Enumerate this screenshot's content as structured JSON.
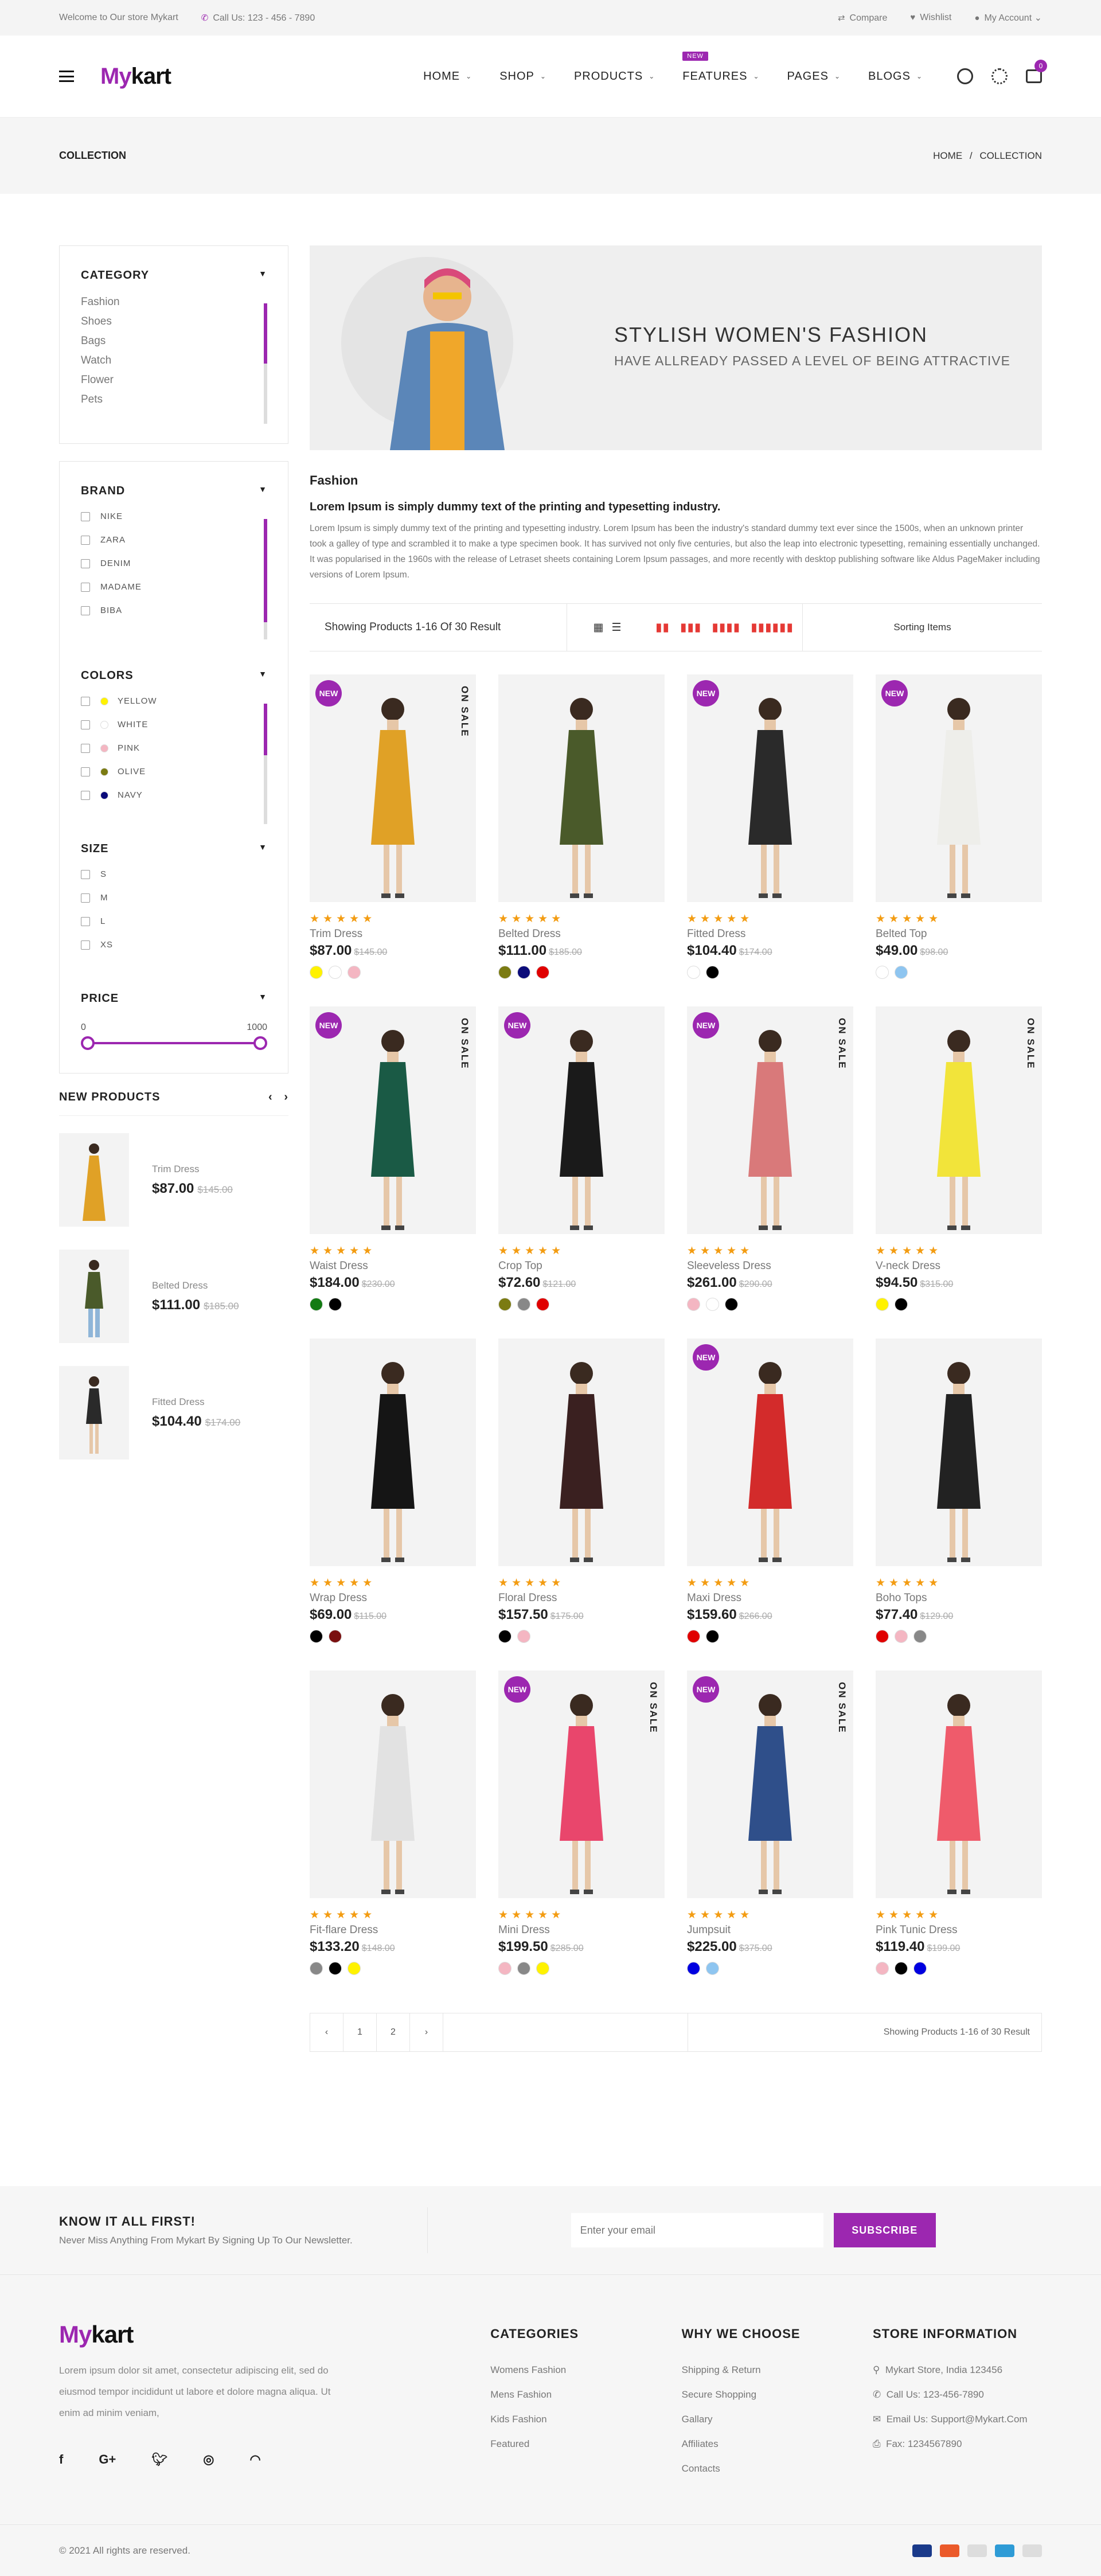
{
  "topbar": {
    "welcome": "Welcome to Our store Mykart",
    "call": "Call Us: 123 - 456 - 7890",
    "compare": "Compare",
    "wishlist": "Wishlist",
    "account": "My Account"
  },
  "header": {
    "logo_a": "My",
    "logo_b": "kart",
    "nav": [
      "HOME",
      "SHOP",
      "PRODUCTS",
      "FEATURES",
      "PAGES",
      "BLOGS"
    ],
    "new_tag": "NEW",
    "cart_count": "0"
  },
  "crumb": {
    "title": "COLLECTION",
    "home": "HOME",
    "sep": "/",
    "current": "COLLECTION"
  },
  "sidebar": {
    "category_title": "CATEGORY",
    "categories": [
      "Fashion",
      "Shoes",
      "Bags",
      "Watch",
      "Flower",
      "Pets"
    ],
    "brand_title": "BRAND",
    "brands": [
      "NIKE",
      "ZARA",
      "DENIM",
      "MADAME",
      "BIBA"
    ],
    "colors_title": "COLORS",
    "colors": [
      {
        "name": "YELLOW",
        "hex": "#fff200"
      },
      {
        "name": "WHITE",
        "hex": "#ffffff"
      },
      {
        "name": "PINK",
        "hex": "#f4b6c2"
      },
      {
        "name": "OLIVE",
        "hex": "#7b7b12"
      },
      {
        "name": "NAVY",
        "hex": "#0b0b7a"
      }
    ],
    "size_title": "SIZE",
    "sizes": [
      "S",
      "M",
      "L",
      "XS"
    ],
    "price_title": "PRICE",
    "price_min": "0",
    "price_max": "1000",
    "new_products_title": "NEW PRODUCTS",
    "new_products": [
      {
        "name": "Trim Dress",
        "price": "$87.00",
        "old": "$145.00"
      },
      {
        "name": "Belted Dress",
        "price": "$111.00",
        "old": "$185.00"
      },
      {
        "name": "Fitted Dress",
        "price": "$104.40",
        "old": "$174.00"
      }
    ]
  },
  "banner": {
    "title": "STYLISH WOMEN'S FASHION",
    "subtitle": "HAVE ALLREADY PASSED A LEVEL OF BEING ATTRACTIVE"
  },
  "desc": {
    "heading": "Fashion",
    "strong": "Lorem Ipsum is simply dummy text of the printing and typesetting industry.",
    "body": "Lorem Ipsum is simply dummy text of the printing and typesetting industry. Lorem Ipsum has been the industry's standard dummy text ever since the 1500s, when an unknown printer took a galley of type and scrambled it to make a type specimen book. It has survived not only five centuries, but also the leap into electronic typesetting, remaining essentially unchanged. It was popularised in the 1960s with the release of Letraset sheets containing Lorem Ipsum passages, and more recently with desktop publishing software like Aldus PageMaker including versions of Lorem Ipsum."
  },
  "toolbar": {
    "showing": "Showing Products 1-16 Of 30 Result",
    "sort": "Sorting Items"
  },
  "badges": {
    "new": "NEW",
    "sale": "ON SALE"
  },
  "products": [
    {
      "name": "Trim Dress",
      "price": "$87.00",
      "old": "$145.00",
      "new": true,
      "sale": true,
      "swatches": [
        "#fff200",
        "#ffffff",
        "#f4b6c2"
      ],
      "dress": "#e0a126"
    },
    {
      "name": "Belted Dress",
      "price": "$111.00",
      "old": "$185.00",
      "new": false,
      "sale": false,
      "swatches": [
        "#7b7b12",
        "#0b0b7a",
        "#e00000"
      ],
      "dress": "#4a5a2a"
    },
    {
      "name": "Fitted Dress",
      "price": "$104.40",
      "old": "$174.00",
      "new": true,
      "sale": false,
      "swatches": [
        "#ffffff",
        "#000000"
      ],
      "dress": "#2a2a2a"
    },
    {
      "name": "Belted Top",
      "price": "$49.00",
      "old": "$98.00",
      "new": true,
      "sale": false,
      "swatches": [
        "#ffffff",
        "#8ec5f0"
      ],
      "dress": "#eeeeea"
    },
    {
      "name": "Waist Dress",
      "price": "$184.00",
      "old": "$230.00",
      "new": true,
      "sale": true,
      "swatches": [
        "#137b13",
        "#000000"
      ],
      "dress": "#1a5a45"
    },
    {
      "name": "Crop Top",
      "price": "$72.60",
      "old": "$121.00",
      "new": true,
      "sale": false,
      "swatches": [
        "#7b7b12",
        "#888888",
        "#e00000"
      ],
      "dress": "#1a1a1a"
    },
    {
      "name": "Sleeveless Dress",
      "price": "$261.00",
      "old": "$290.00",
      "new": true,
      "sale": true,
      "swatches": [
        "#f4b6c2",
        "#ffffff",
        "#000000"
      ],
      "dress": "#d9797a"
    },
    {
      "name": "V-neck Dress",
      "price": "$94.50",
      "old": "$315.00",
      "new": false,
      "sale": true,
      "swatches": [
        "#fff200",
        "#000000"
      ],
      "dress": "#f2e43a"
    },
    {
      "name": "Wrap Dress",
      "price": "$69.00",
      "old": "$115.00",
      "new": false,
      "sale": false,
      "swatches": [
        "#000000",
        "#7a1010"
      ],
      "dress": "#151515"
    },
    {
      "name": "Floral Dress",
      "price": "$157.50",
      "old": "$175.00",
      "new": false,
      "sale": false,
      "swatches": [
        "#000000",
        "#f4b6c2"
      ],
      "dress": "#3a2020"
    },
    {
      "name": "Maxi Dress",
      "price": "$159.60",
      "old": "$266.00",
      "new": true,
      "sale": false,
      "swatches": [
        "#e00000",
        "#000000"
      ],
      "dress": "#d32b2b"
    },
    {
      "name": "Boho Tops",
      "price": "$77.40",
      "old": "$129.00",
      "new": false,
      "sale": false,
      "swatches": [
        "#e00000",
        "#f4b6c2",
        "#888888"
      ],
      "dress": "#222222"
    },
    {
      "name": "Fit-flare Dress",
      "price": "$133.20",
      "old": "$148.00",
      "new": false,
      "sale": false,
      "swatches": [
        "#888888",
        "#000000",
        "#fff200"
      ],
      "dress": "#e2e2e2"
    },
    {
      "name": "Mini Dress",
      "price": "$199.50",
      "old": "$285.00",
      "new": true,
      "sale": true,
      "swatches": [
        "#f4b6c2",
        "#888888",
        "#fff200"
      ],
      "dress": "#e9466c"
    },
    {
      "name": "Jumpsuit",
      "price": "$225.00",
      "old": "$375.00",
      "new": true,
      "sale": true,
      "swatches": [
        "#0000e0",
        "#8ec5f0"
      ],
      "dress": "#2f4f8a"
    },
    {
      "name": "Pink Tunic Dress",
      "price": "$119.40",
      "old": "$199.00",
      "new": false,
      "sale": false,
      "swatches": [
        "#f4b6c2",
        "#000000",
        "#0000e0"
      ],
      "dress": "#ef5b6b"
    }
  ],
  "pager": {
    "pages": [
      "1",
      "2"
    ],
    "info": "Showing Products 1-16 of 30 Result"
  },
  "footer": {
    "news_title": "KNOW IT ALL FIRST!",
    "news_sub": "Never Miss Anything From Mykart By Signing Up To Our Newsletter.",
    "email_placeholder": "Enter your email",
    "subscribe": "SUBSCRIBE",
    "about": "Lorem ipsum dolor sit amet, consectetur adipiscing elit, sed do eiusmod tempor incididunt ut labore et dolore magna aliqua. Ut enim ad minim veniam,",
    "cat_title": "CATEGORIES",
    "categories": [
      "Womens Fashion",
      "Mens Fashion",
      "Kids Fashion",
      "Featured"
    ],
    "why_title": "WHY WE CHOOSE",
    "why": [
      "Shipping & Return",
      "Secure Shopping",
      "Gallary",
      "Affiliates",
      "Contacts"
    ],
    "store_title": "STORE INFORMATION",
    "store": [
      "Mykart Store, India 123456",
      "Call Us: 123-456-7890",
      "Email Us: Support@Mykart.Com",
      "Fax: 1234567890"
    ],
    "copyright": "© 2021 All rights are reserved."
  },
  "accent": "#9c27b0"
}
